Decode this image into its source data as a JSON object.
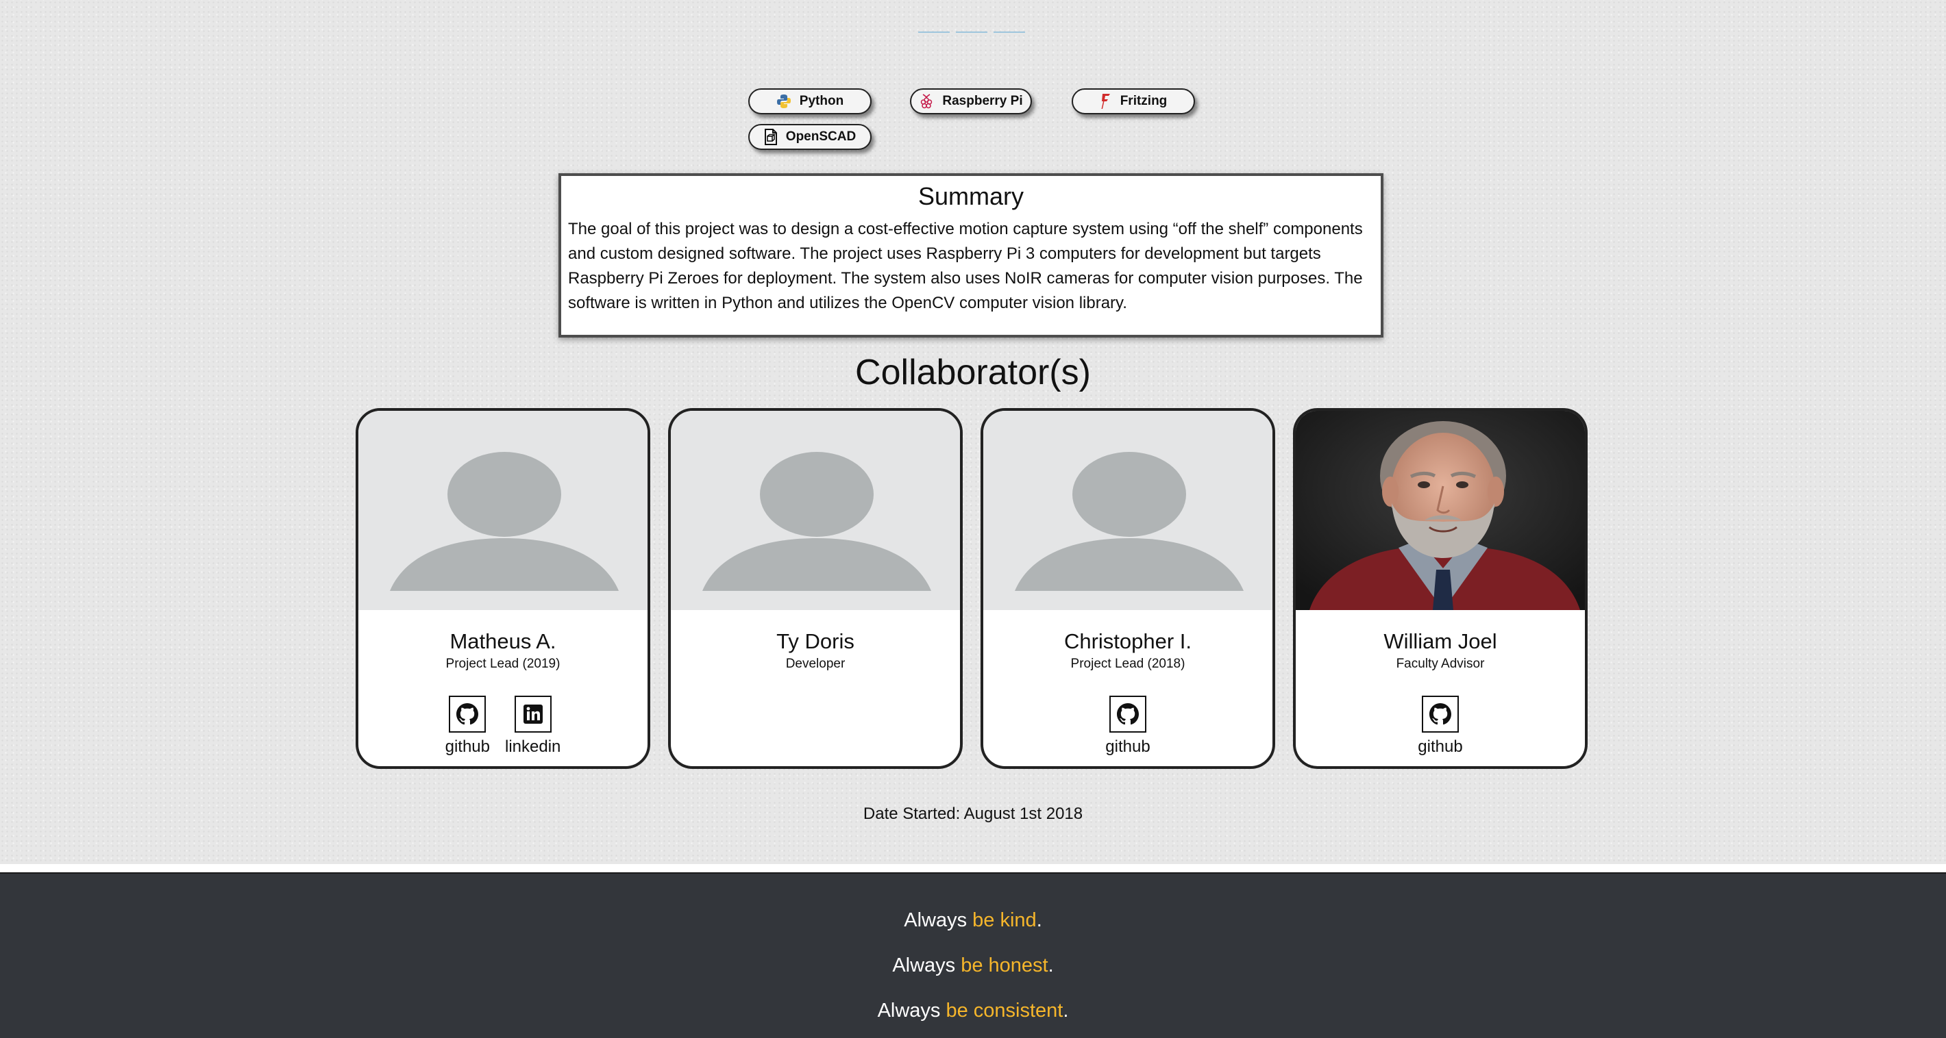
{
  "tech_tags": [
    {
      "label": "Python",
      "icon": "python-icon"
    },
    {
      "label": "Raspberry Pi",
      "icon": "raspberry-pi-icon"
    },
    {
      "label": "Fritzing",
      "icon": "fritzing-icon"
    },
    {
      "label": "OpenSCAD",
      "icon": "openscad-icon"
    }
  ],
  "summary": {
    "title": "Summary",
    "text": "The goal of this project was to design a cost-effective motion capture system using “off the shelf” components and custom designed software. The project uses Raspberry Pi 3 computers for development but targets Raspberry Pi Zeroes for deployment. The system also uses NoIR cameras for computer vision purposes. The software is written in Python and utilizes the OpenCV computer vision library."
  },
  "collaborators_title": "Collaborator(s)",
  "collaborators": [
    {
      "name": "Matheus A.",
      "role": "Project Lead (2019)",
      "photo": "placeholder-avatar",
      "links": [
        {
          "label": "github",
          "icon": "github-icon"
        },
        {
          "label": "linkedin",
          "icon": "linkedin-icon"
        }
      ]
    },
    {
      "name": "Ty Doris",
      "role": "Developer",
      "photo": "placeholder-avatar",
      "links": []
    },
    {
      "name": "Christopher I.",
      "role": "Project Lead (2018)",
      "photo": "placeholder-avatar",
      "links": [
        {
          "label": "github",
          "icon": "github-icon"
        }
      ]
    },
    {
      "name": "William Joel",
      "role": "Faculty Advisor",
      "photo": "portrait-photo",
      "links": [
        {
          "label": "github",
          "icon": "github-icon"
        }
      ]
    }
  ],
  "date_started": "Date Started: August 1st 2018",
  "footer": {
    "mottos": [
      {
        "prefix": "Always ",
        "highlight": "be kind",
        "suffix": "."
      },
      {
        "prefix": "Always ",
        "highlight": "be honest",
        "suffix": "."
      },
      {
        "prefix": "Always ",
        "highlight": "be consistent",
        "suffix": "."
      }
    ]
  },
  "colors": {
    "background": "#e7e7e7",
    "footer": "#33363b",
    "highlight": "#f6b62b",
    "avatar_bg": "#e4e5e6",
    "avatar_fg": "#b0b4b5"
  }
}
